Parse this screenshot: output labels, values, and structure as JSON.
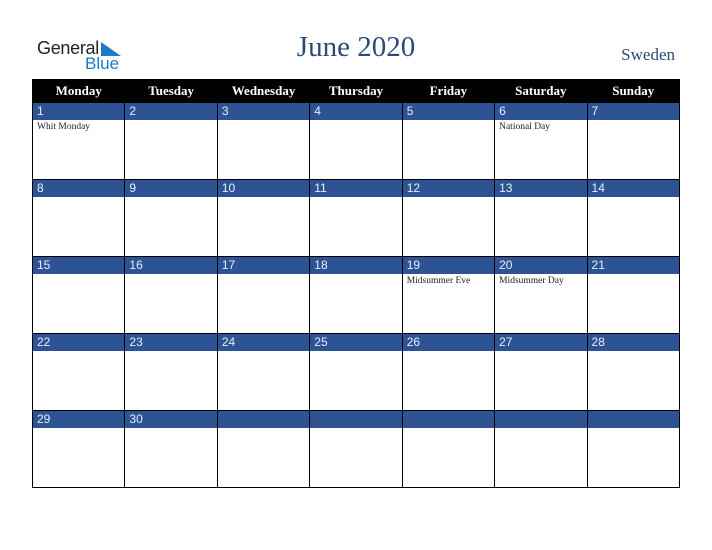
{
  "logo": {
    "line1": "General",
    "line2": "Blue",
    "accent_color": "#1f7ac4"
  },
  "title": "June 2020",
  "country": "Sweden",
  "colors": {
    "header_bg": "#000000",
    "date_bar": "#2d5394",
    "title": "#2b4a78"
  },
  "weekdays": [
    "Monday",
    "Tuesday",
    "Wednesday",
    "Thursday",
    "Friday",
    "Saturday",
    "Sunday"
  ],
  "weeks": [
    [
      {
        "day": "1",
        "holiday": "Whit Monday"
      },
      {
        "day": "2",
        "holiday": ""
      },
      {
        "day": "3",
        "holiday": ""
      },
      {
        "day": "4",
        "holiday": ""
      },
      {
        "day": "5",
        "holiday": ""
      },
      {
        "day": "6",
        "holiday": "National Day"
      },
      {
        "day": "7",
        "holiday": ""
      }
    ],
    [
      {
        "day": "8",
        "holiday": ""
      },
      {
        "day": "9",
        "holiday": ""
      },
      {
        "day": "10",
        "holiday": ""
      },
      {
        "day": "11",
        "holiday": ""
      },
      {
        "day": "12",
        "holiday": ""
      },
      {
        "day": "13",
        "holiday": ""
      },
      {
        "day": "14",
        "holiday": ""
      }
    ],
    [
      {
        "day": "15",
        "holiday": ""
      },
      {
        "day": "16",
        "holiday": ""
      },
      {
        "day": "17",
        "holiday": ""
      },
      {
        "day": "18",
        "holiday": ""
      },
      {
        "day": "19",
        "holiday": "Midsummer Eve"
      },
      {
        "day": "20",
        "holiday": "Midsummer Day"
      },
      {
        "day": "21",
        "holiday": ""
      }
    ],
    [
      {
        "day": "22",
        "holiday": ""
      },
      {
        "day": "23",
        "holiday": ""
      },
      {
        "day": "24",
        "holiday": ""
      },
      {
        "day": "25",
        "holiday": ""
      },
      {
        "day": "26",
        "holiday": ""
      },
      {
        "day": "27",
        "holiday": ""
      },
      {
        "day": "28",
        "holiday": ""
      }
    ],
    [
      {
        "day": "29",
        "holiday": ""
      },
      {
        "day": "30",
        "holiday": ""
      },
      {
        "day": "",
        "holiday": ""
      },
      {
        "day": "",
        "holiday": ""
      },
      {
        "day": "",
        "holiday": ""
      },
      {
        "day": "",
        "holiday": ""
      },
      {
        "day": "",
        "holiday": ""
      }
    ]
  ]
}
